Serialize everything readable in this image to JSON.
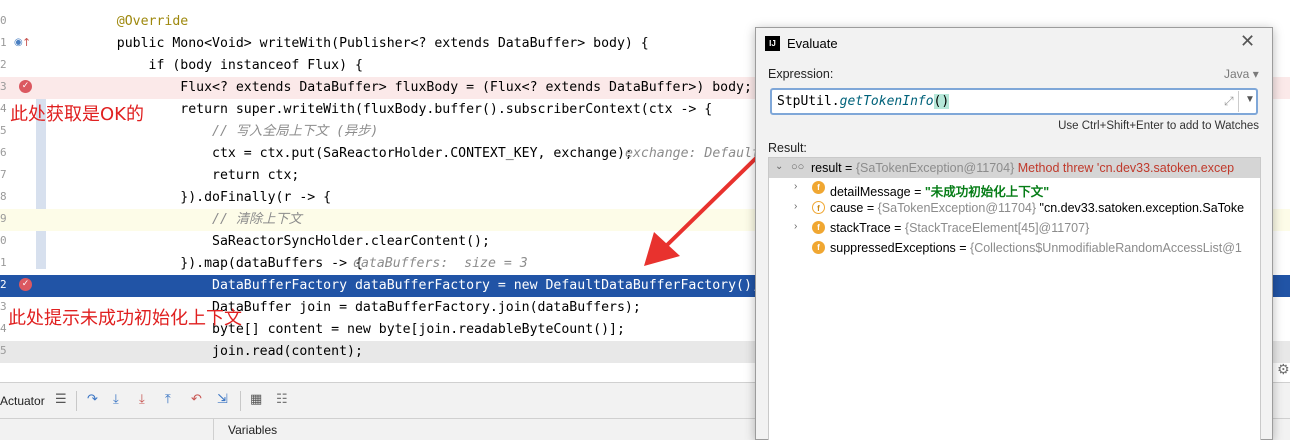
{
  "editor": {
    "lines": [
      {
        "ln": "0",
        "code": "    @Override"
      },
      {
        "ln": "1",
        "code": "    public Mono<Void> writeWith(Publisher<? extends DataBuffer> body) {"
      },
      {
        "ln": "2",
        "code": "        if (body instanceof Flux) {"
      },
      {
        "ln": "3",
        "code": "            Flux<? extends DataBuffer> fluxBody = (Flux<? extends DataBuffer>) body;"
      },
      {
        "ln": "4",
        "code": "            return super.writeWith(fluxBody.buffer().subscriberContext(ctx -> {"
      },
      {
        "ln": "5",
        "code": "                // 写入全局上下文 (异步)"
      },
      {
        "ln": "6",
        "code": "                ctx = ctx.put(SaReactorHolder.CONTEXT_KEY, exchange);",
        "hint": "exchange: Default"
      },
      {
        "ln": "7",
        "code": "                return ctx;"
      },
      {
        "ln": "8",
        "code": "            }).doFinally(r -> {"
      },
      {
        "ln": "9",
        "code": "                // 清除上下文"
      },
      {
        "ln": "0",
        "code": "                SaReactorSyncHolder.clearContent();"
      },
      {
        "ln": "1",
        "code": "            }).map(dataBuffers -> {",
        "hint": "dataBuffers:  size = 3"
      },
      {
        "ln": "2",
        "code": "                DataBufferFactory dataBufferFactory = new DefaultDataBufferFactory();"
      },
      {
        "ln": "3",
        "code": "                DataBuffer join = dataBufferFactory.join(dataBuffers);"
      },
      {
        "ln": "4",
        "code": "                byte[] content = new byte[join.readableByteCount()];"
      },
      {
        "ln": "5",
        "code": "                join.read(content);"
      }
    ]
  },
  "annotations": {
    "note_ok": "此处获取是OK的",
    "note_fail": "此处提示未成功初始化上下文"
  },
  "toolbar": {
    "label": "Actuator"
  },
  "variables": {
    "tab": "Variables"
  },
  "dialog": {
    "title": "Evaluate",
    "expression_label": "Expression:",
    "language": "Java",
    "expression": {
      "prefix": "StpUtil.",
      "method": "getTokenInfo",
      "parens": "()"
    },
    "watch_hint": "Use Ctrl+Shift+Enter to add to Watches",
    "result_label": "Result:",
    "tree": {
      "result": {
        "name": "result",
        "eq": " = ",
        "value": "{SaTokenException@11704}",
        "msg": " Method threw 'cn.dev33.satoken.excep"
      },
      "children": [
        {
          "name": "detailMessage",
          "eq": " = ",
          "value": "\"未成功初始化上下文\""
        },
        {
          "name": "cause",
          "eq": " = ",
          "value": "{SaTokenException@11704}",
          "extra": " \"cn.dev33.satoken.exception.SaToke"
        },
        {
          "name": "stackTrace",
          "eq": " = ",
          "value": "{StackTraceElement[45]@11707}"
        },
        {
          "name": "suppressedExceptions",
          "eq": " = ",
          "value": "{Collections$UnmodifiableRandomAccessList@1"
        }
      ]
    }
  },
  "colors": {
    "selection": "#2154a6",
    "annotation_red": "#e02020",
    "breakpoint": "#db5860"
  }
}
